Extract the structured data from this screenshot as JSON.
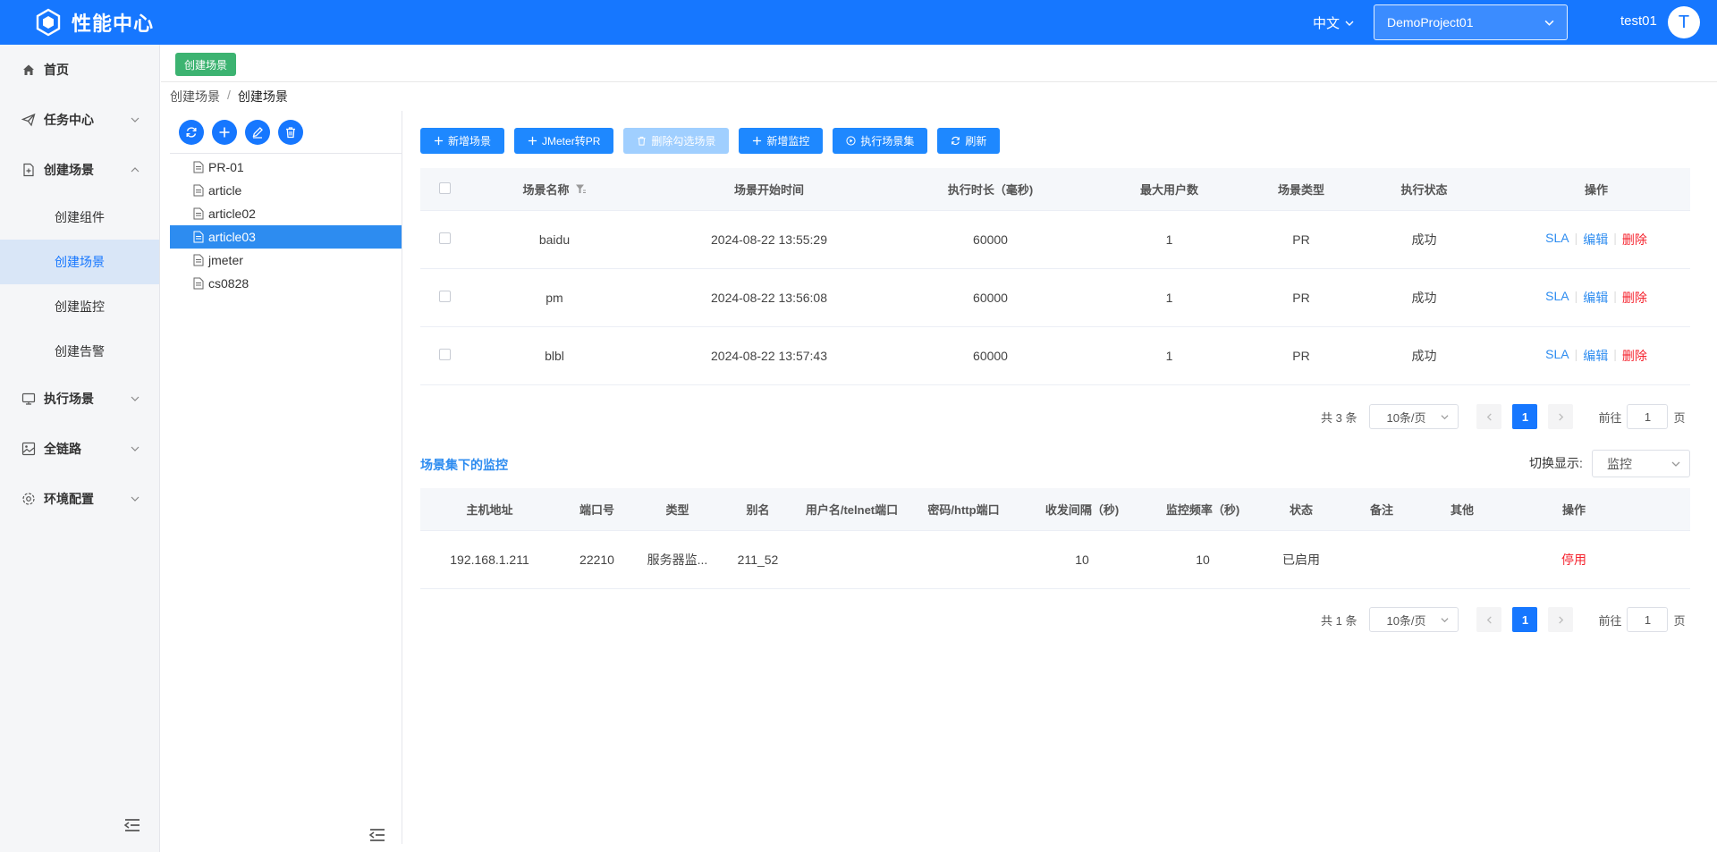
{
  "header": {
    "app_title": "性能中心",
    "lang": "中文",
    "project": "DemoProject01",
    "user": "test01",
    "avatar_letter": "T"
  },
  "sidebar": {
    "items": [
      {
        "label": "首页"
      },
      {
        "label": "任务中心"
      },
      {
        "label": "创建场景",
        "children": [
          {
            "label": "创建组件"
          },
          {
            "label": "创建场景"
          },
          {
            "label": "创建监控"
          },
          {
            "label": "创建告警"
          }
        ]
      },
      {
        "label": "执行场景"
      },
      {
        "label": "全链路"
      },
      {
        "label": "环境配置"
      }
    ]
  },
  "tag": {
    "label": "创建场景"
  },
  "breadcrumb": {
    "parent": "创建场景",
    "separator": "/",
    "current": "创建场景"
  },
  "tree": {
    "nodes": [
      "PR-01",
      "article",
      "article02",
      "article03",
      "jmeter",
      "cs0828"
    ]
  },
  "toolbar": {
    "add_scene": "新增场景",
    "jmeter_to_pr": "JMeter转PR",
    "delete_selected": "删除勾选场景",
    "add_monitor": "新增监控",
    "run_set": "执行场景集",
    "refresh": "刷新"
  },
  "scene_table": {
    "headers": [
      "场景名称",
      "场景开始时间",
      "执行时长（毫秒)",
      "最大用户数",
      "场景类型",
      "执行状态",
      "操作"
    ],
    "rows": [
      {
        "name": "baidu",
        "start": "2024-08-22 13:55:29",
        "duration": "60000",
        "max_users": "1",
        "type": "PR",
        "status": "成功"
      },
      {
        "name": "pm",
        "start": "2024-08-22 13:56:08",
        "duration": "60000",
        "max_users": "1",
        "type": "PR",
        "status": "成功"
      },
      {
        "name": "blbl",
        "start": "2024-08-22 13:57:43",
        "duration": "60000",
        "max_users": "1",
        "type": "PR",
        "status": "成功"
      }
    ],
    "ops": {
      "sla": "SLA",
      "edit": "编辑",
      "delete": "删除"
    }
  },
  "pager1": {
    "total": "共 3 条",
    "size": "10条/页",
    "page": "1",
    "goto": "前往",
    "goto_value": "1",
    "page_unit": "页"
  },
  "monitor_section": {
    "title": "场景集下的监控",
    "switch_label": "切换显示:",
    "switch_value": "监控"
  },
  "monitor_table": {
    "headers": [
      "主机地址",
      "端口号",
      "类型",
      "别名",
      "用户名/telnet端口",
      "密码/http端口",
      "收发间隔（秒)",
      "监控频率（秒)",
      "状态",
      "备注",
      "其他",
      "操作"
    ],
    "rows": [
      {
        "host": "192.168.1.211",
        "port": "22210",
        "type": "服务器监...",
        "alias": "211_52",
        "user": "",
        "password": "",
        "interval": "10",
        "freq": "10",
        "status": "已启用",
        "remark": "",
        "other": "",
        "op": "停用"
      }
    ]
  },
  "pager2": {
    "total": "共 1 条",
    "size": "10条/页",
    "page": "1",
    "goto": "前往",
    "goto_value": "1",
    "page_unit": "页"
  },
  "colors": {
    "primary": "#1677ff",
    "danger": "#f5222d",
    "tag": "#3cb371"
  }
}
